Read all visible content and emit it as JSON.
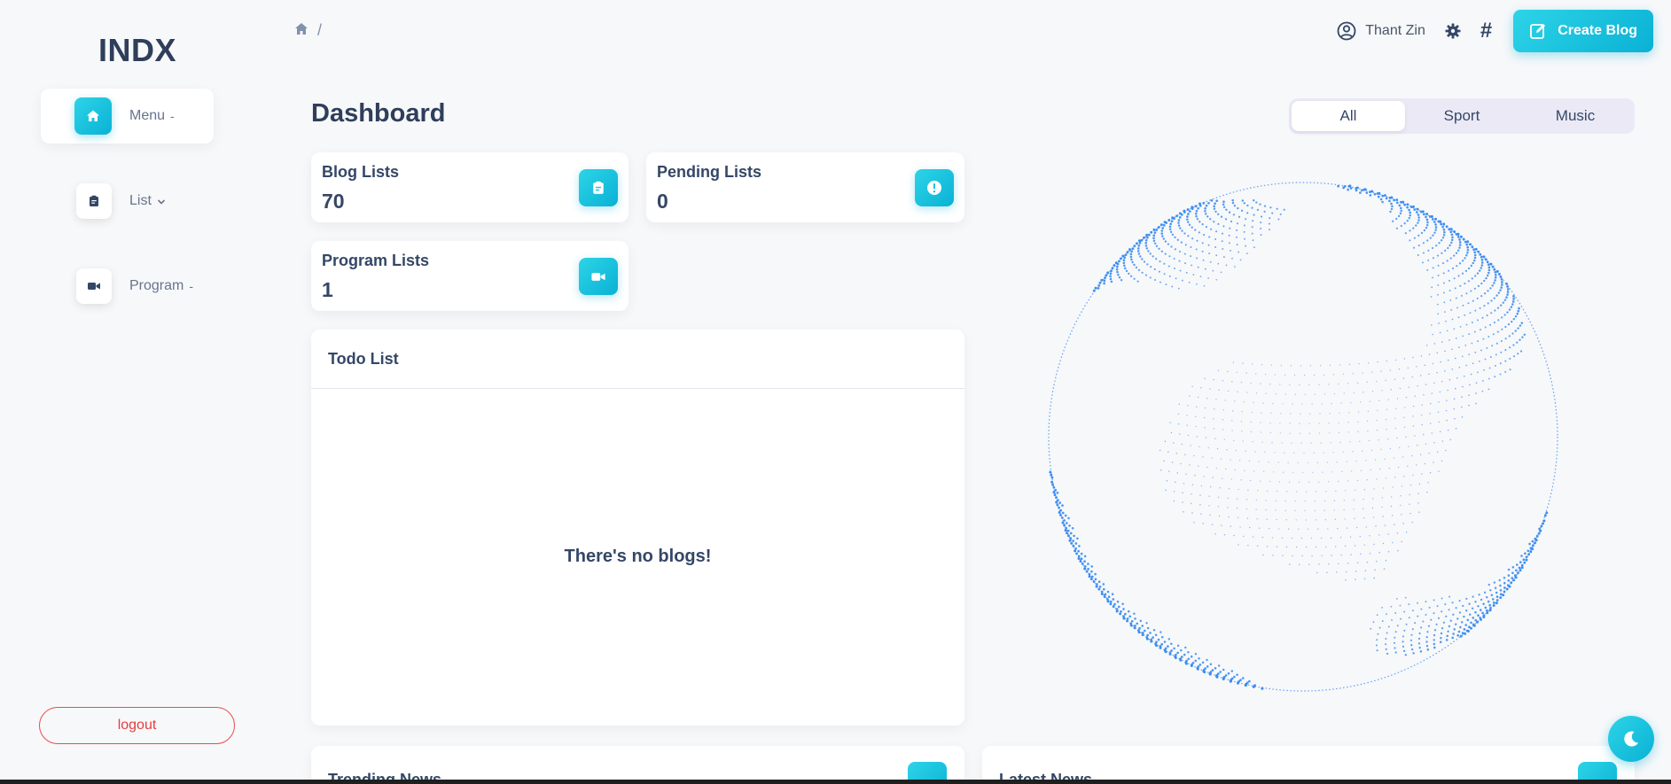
{
  "brand": "INDX",
  "sidebar": {
    "items": [
      {
        "label": "Menu",
        "caret": "-",
        "icon": "home-icon",
        "active": true
      },
      {
        "label": "List",
        "caret": "⌄",
        "icon": "clipboard-icon",
        "active": false
      },
      {
        "label": "Program",
        "caret": "-",
        "icon": "video-icon",
        "active": false
      }
    ],
    "logout_label": "logout"
  },
  "breadcrumb": {
    "icon": "home-icon",
    "separator": "/"
  },
  "topbar": {
    "user_name": "Thant Zin",
    "hash_symbol": "#",
    "create_label": "Create Blog"
  },
  "page_title": "Dashboard",
  "filter_tabs": [
    {
      "label": "All",
      "active": true
    },
    {
      "label": "Sport",
      "active": false
    },
    {
      "label": "Music",
      "active": false
    }
  ],
  "stats": [
    {
      "label": "Blog Lists",
      "value": "70",
      "icon": "clipboard-icon"
    },
    {
      "label": "Pending Lists",
      "value": "0",
      "icon": "alert-icon"
    },
    {
      "label": "Program Lists",
      "value": "1",
      "icon": "video-icon"
    }
  ],
  "todo": {
    "title": "Todo List",
    "empty_message": "There's no blogs!"
  },
  "news": [
    {
      "title": "Trending News"
    },
    {
      "title": "Latest News"
    }
  ],
  "colors": {
    "accent": "#17c1e8",
    "text": "#344767",
    "globe": "#3b8cf0",
    "logout": "#e53e3e"
  }
}
